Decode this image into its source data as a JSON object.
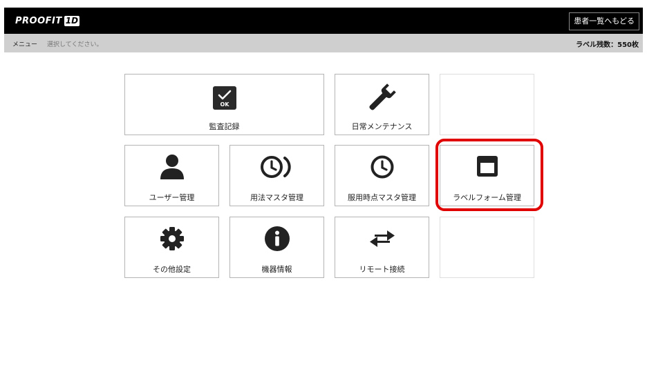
{
  "header": {
    "logo_text": "PROOFIT",
    "logo_badge": "1D",
    "back_label": "患者一覧へもどる"
  },
  "subheader": {
    "menu_label": "メニュー",
    "instruction": "選択してください。",
    "label_count": "ラベル残数：550枚"
  },
  "menu": {
    "audit_log": "監査記録",
    "daily_maintenance": "日常メンテナンス",
    "user_management": "ユーザー管理",
    "dosage_master": "用法マスタ管理",
    "timing_master": "服用時点マスタ管理",
    "label_form": "ラベルフォーム管理",
    "other_settings": "その他設定",
    "device_info": "機器情報",
    "remote_connection": "リモート接続",
    "ok_badge": "OK"
  },
  "colors": {
    "highlight": "#e00000",
    "icon": "#222222",
    "topbar": "#000000",
    "subbar": "#cfcfcf"
  }
}
